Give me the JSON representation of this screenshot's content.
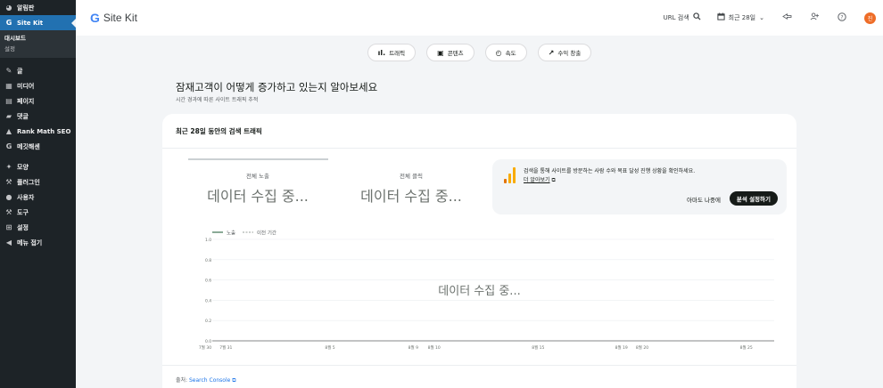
{
  "sidebar": {
    "items": [
      {
        "icon": "dashboard-icon",
        "glyph": "◕",
        "label": "알림판"
      },
      {
        "icon": "sitekit-icon",
        "glyph": "G",
        "label": "Site Kit",
        "active": true
      },
      {
        "icon": "pin-icon",
        "glyph": "✎",
        "label": "글"
      },
      {
        "icon": "media-icon",
        "glyph": "▦",
        "label": "미디어"
      },
      {
        "icon": "page-icon",
        "glyph": "▤",
        "label": "페이지"
      },
      {
        "icon": "comment-icon",
        "glyph": "▰",
        "label": "댓글"
      },
      {
        "icon": "rank-math-icon",
        "glyph": "▲",
        "label": "Rank Math SEO"
      },
      {
        "icon": "google-icon",
        "glyph": "G",
        "label": "메깃해센"
      },
      {
        "icon": "appearance-icon",
        "glyph": "✦",
        "label": "모양"
      },
      {
        "icon": "plugin-icon",
        "glyph": "⚒",
        "label": "플러그인"
      },
      {
        "icon": "users-icon",
        "glyph": "●",
        "label": "사용자"
      },
      {
        "icon": "tools-icon",
        "glyph": "⚒",
        "label": "도구"
      },
      {
        "icon": "settings-icon",
        "glyph": "⊞",
        "label": "설정"
      },
      {
        "icon": "collapse-icon",
        "glyph": "◀",
        "label": "메뉴 접기"
      }
    ],
    "sub": {
      "dashboard": "대시보드",
      "settings": "설정"
    }
  },
  "header": {
    "brand": "Site Kit",
    "url_search": "URL 검색",
    "date_range": "최근 28일",
    "avatar": "진"
  },
  "nav": {
    "traffic": "트래픽",
    "content": "콘텐츠",
    "speed": "속도",
    "monetization": "수익 창출"
  },
  "section": {
    "title": "잠재고객이 어떻게 증가하고 있는지 알아보세요",
    "subtitle": "시간 경과에 따른 사이트 트래픽 추적"
  },
  "card": {
    "title": "최근 28일 동안의 검색 트래픽",
    "metrics": [
      {
        "label": "전체 노출",
        "value": "데이터 수집 중..."
      },
      {
        "label": "전체 클릭",
        "value": "데이터 수집 중..."
      }
    ],
    "promo": {
      "text": "검색을 통해 사이트를 방문하는 사람 수와 목표 달성 진행 상황을 확인하세요.",
      "link": "더 알아보기",
      "later": "아마도 나중에",
      "cta": "분석 설정하기"
    },
    "chart_loading": "데이터 수집 중...",
    "source_label": "출처:",
    "source_link": "Search Console"
  },
  "colors": {
    "sidebar_bg": "#1d2327",
    "active": "#2271b1",
    "link": "#1a73e8",
    "cta_bg": "#161b18",
    "analytics_orange": "#f9ab00",
    "analytics_dark": "#e37400"
  },
  "chart_data": {
    "type": "line",
    "series": [
      {
        "name": "노출",
        "values": []
      },
      {
        "name": "이전 기간",
        "values": []
      }
    ],
    "yticks": [
      "1.0",
      "0.8",
      "0.6",
      "0.4",
      "0.2",
      "0.0"
    ],
    "ylim": [
      0,
      1.0
    ],
    "xticks": [
      "7월 30",
      "7월 31",
      "8월 5",
      "8월 9",
      "8월 10",
      "8월 15",
      "8월 19",
      "8월 20",
      "8월 25"
    ],
    "grid": true,
    "legend": "top-left"
  }
}
